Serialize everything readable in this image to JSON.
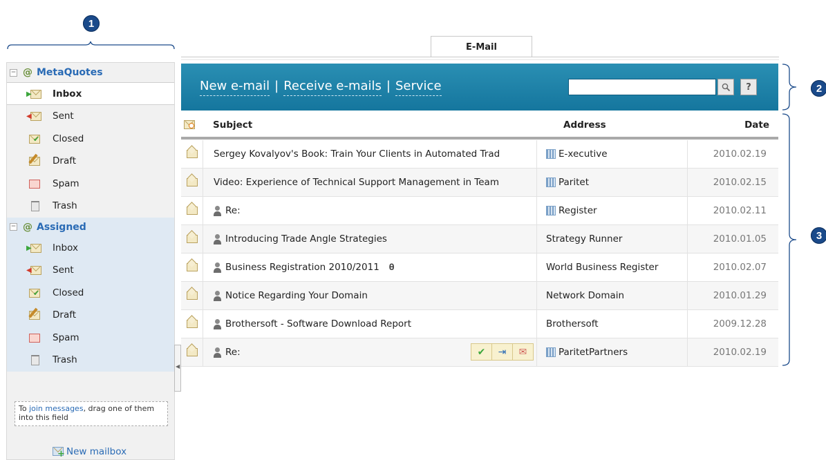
{
  "callouts": [
    "1",
    "2",
    "3"
  ],
  "tab": {
    "label": "E-Mail"
  },
  "sidebar": {
    "groups": [
      {
        "name": "MetaQuotes",
        "items": [
          {
            "label": "Inbox",
            "icon": "inbox-icon",
            "selected": true
          },
          {
            "label": "Sent",
            "icon": "sent-icon"
          },
          {
            "label": "Closed",
            "icon": "closed-icon"
          },
          {
            "label": "Draft",
            "icon": "draft-icon"
          },
          {
            "label": "Spam",
            "icon": "spam-icon"
          },
          {
            "label": "Trash",
            "icon": "trash-icon"
          }
        ]
      },
      {
        "name": "Assigned",
        "items": [
          {
            "label": "Inbox",
            "icon": "inbox-icon"
          },
          {
            "label": "Sent",
            "icon": "sent-icon"
          },
          {
            "label": "Closed",
            "icon": "closed-icon"
          },
          {
            "label": "Draft",
            "icon": "draft-icon"
          },
          {
            "label": "Spam",
            "icon": "spam-icon"
          },
          {
            "label": "Trash",
            "icon": "trash-icon"
          }
        ]
      }
    ],
    "join": {
      "prefix": "To ",
      "link": "join messages",
      "suffix": ", drag one of them into this field"
    },
    "new_mailbox": "New mailbox"
  },
  "toolbar": {
    "new_email": "New e-mail",
    "receive": "Receive e-mails",
    "service": "Service",
    "separator": "|",
    "search_placeholder": "",
    "help": "?"
  },
  "table": {
    "headers": {
      "subject": "Subject",
      "address": "Address",
      "date": "Date"
    },
    "rows": [
      {
        "subject": "Sergey Kovalyov's Book: Train Your Clients in Automated Trad",
        "address": "E-xecutive",
        "date": "2010.02.19"
      },
      {
        "subject": "Video: Experience of Technical Support Management in Team",
        "address": "Paritet",
        "date": "2010.02.15"
      },
      {
        "subject": "Re:",
        "address": "Register",
        "date": "2010.02.11"
      },
      {
        "subject": "Introducing Trade Angle Strategies",
        "address": "Strategy Runner",
        "date": "2010.01.05"
      },
      {
        "subject": "Business Registration 2010/2011",
        "address": "World Business Register",
        "date": "2010.02.07"
      },
      {
        "subject": "Notice Regarding Your Domain",
        "address": "Network Domain",
        "date": "2010.01.29"
      },
      {
        "subject": "Brothersoft - Software Download Report",
        "address": "Brothersoft",
        "date": "2009.12.28"
      },
      {
        "subject": "Re:",
        "address": "ParitetPartners",
        "date": "2010.02.19"
      }
    ]
  },
  "colors": {
    "banner": "#1b7fa8",
    "link": "#2a6bb5",
    "callout": "#1a4a8a"
  }
}
